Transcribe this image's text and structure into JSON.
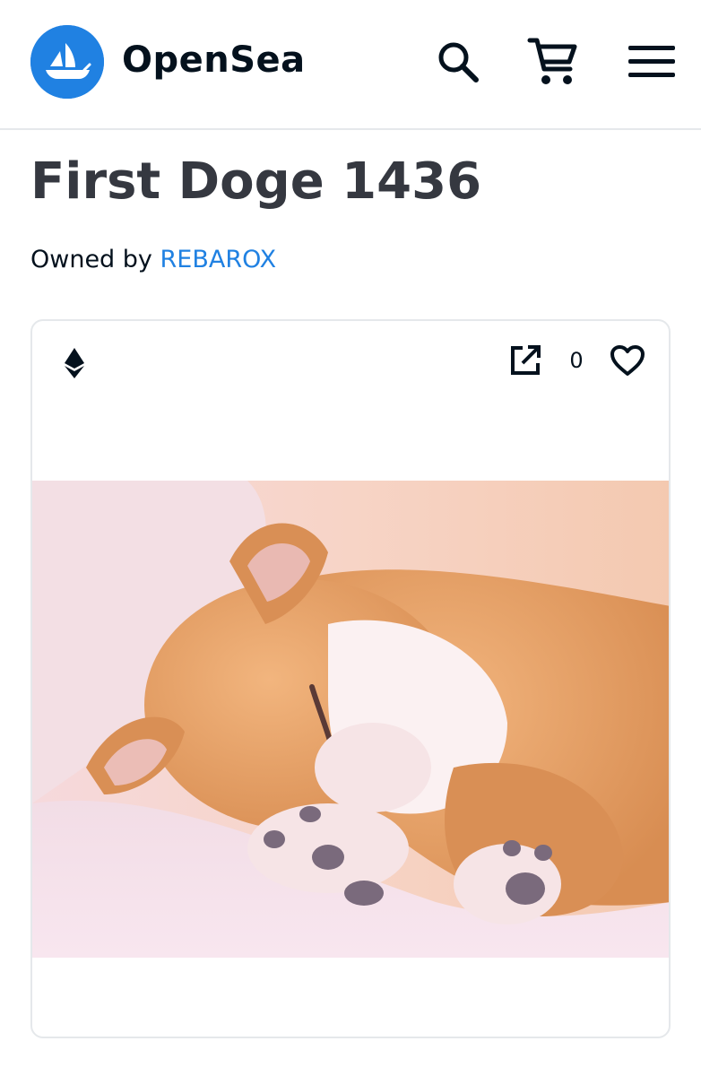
{
  "header": {
    "brand": "OpenSea",
    "icons": {
      "logo": "opensea-logo-icon",
      "search": "search-icon",
      "cart": "cart-icon",
      "menu": "menu-icon"
    },
    "brand_color": "#2081e2"
  },
  "asset": {
    "title": "First Doge 1436",
    "owned_by_label": "Owned by",
    "owner": "REBAROX",
    "chain_icon": "ethereum-icon",
    "external_link_icon": "external-link-icon",
    "favorites_count": "0",
    "favorite_icon": "heart-icon",
    "image": "sleeping-shiba-dog-image"
  },
  "colors": {
    "link": "#2081e2",
    "title": "#353840",
    "border": "#e5e8eb"
  }
}
